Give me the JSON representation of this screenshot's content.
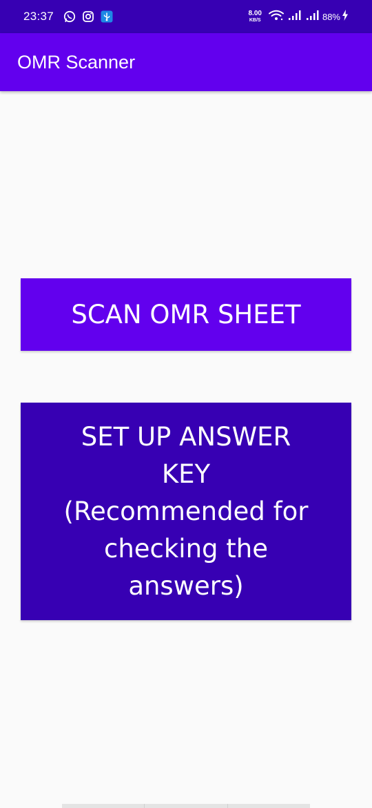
{
  "status_bar": {
    "time": "23:37",
    "icons_left": [
      "whatsapp-icon",
      "instagram-icon",
      "usb-icon"
    ],
    "net_speed_value": "8.00",
    "net_speed_unit": "KB/S",
    "battery_percent": "88%",
    "charging": true,
    "bg_color": "#3700b3"
  },
  "app_bar": {
    "title": "OMR Scanner",
    "bg_color": "#6200ee"
  },
  "buttons": {
    "scan": {
      "label": "SCAN OMR SHEET",
      "bg_color": "#6200ee"
    },
    "answer_key": {
      "lines": [
        "SET UP ANSWER",
        "KEY",
        "(Recommended for",
        "checking the",
        "answers)"
      ],
      "bg_color": "#3700b3"
    }
  }
}
